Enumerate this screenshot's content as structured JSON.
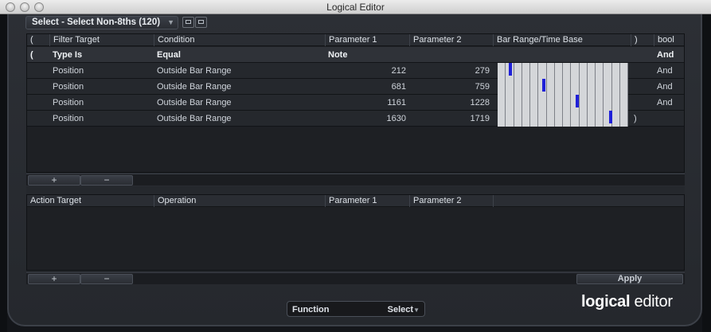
{
  "window": {
    "title": "Logical Editor"
  },
  "preset": {
    "label": "Select - Select Non-8ths (120)"
  },
  "filter": {
    "headers": [
      "(",
      "Filter Target",
      "Condition",
      "Parameter 1",
      "Parameter 2",
      "Bar Range/Time Base",
      ")",
      "bool"
    ],
    "rows": [
      {
        "open": "(",
        "target": "Type Is",
        "condition": "Equal",
        "p1": "Note",
        "p2": "",
        "close": "",
        "bool": "And",
        "bar": null
      },
      {
        "open": "",
        "target": "Position",
        "condition": "Outside Bar Range",
        "p1": "212",
        "p2": "279",
        "close": "",
        "bool": "And",
        "bar": 0.11
      },
      {
        "open": "",
        "target": "Position",
        "condition": "Outside Bar Range",
        "p1": "681",
        "p2": "759",
        "close": "",
        "bool": "And",
        "bar": 0.36
      },
      {
        "open": "",
        "target": "Position",
        "condition": "Outside Bar Range",
        "p1": "1161",
        "p2": "1228",
        "close": "",
        "bool": "And",
        "bar": 0.61
      },
      {
        "open": "",
        "target": "Position",
        "condition": "Outside Bar Range",
        "p1": "1630",
        "p2": "1719",
        "close": ")",
        "bool": "",
        "bar": 0.86
      }
    ]
  },
  "action": {
    "headers": [
      "Action Target",
      "Operation",
      "Parameter 1",
      "Parameter 2"
    ]
  },
  "controls": {
    "add": "+",
    "remove": "−",
    "apply": "Apply"
  },
  "function": {
    "label": "Function",
    "value": "Select"
  },
  "brand": {
    "bold": "logical",
    "light": "editor"
  },
  "colors": {
    "bar_selection": "#1f20d8",
    "bar_cell": "#d4d6d9"
  }
}
